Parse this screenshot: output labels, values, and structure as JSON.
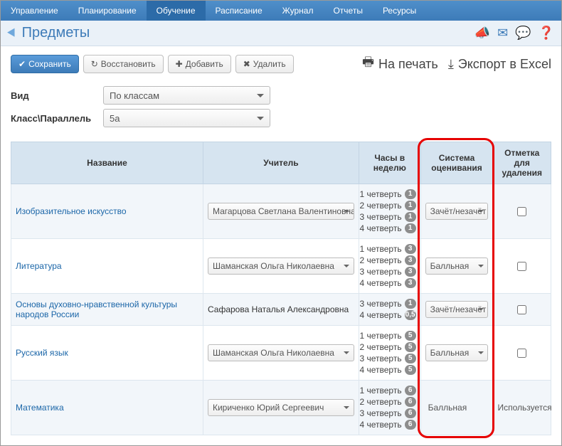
{
  "nav": {
    "items": [
      {
        "label": "Управление"
      },
      {
        "label": "Планирование"
      },
      {
        "label": "Обучение",
        "active": true
      },
      {
        "label": "Расписание"
      },
      {
        "label": "Журнал"
      },
      {
        "label": "Отчеты"
      },
      {
        "label": "Ресурсы"
      }
    ]
  },
  "page_title": "Предметы",
  "toolbar": {
    "save_label": "Сохранить",
    "restore_label": "Восстановить",
    "add_label": "Добавить",
    "delete_label": "Удалить",
    "print_label": "На печать",
    "export_label": "Экспорт в Excel"
  },
  "filters": {
    "view_label": "Вид",
    "view_value": "По классам",
    "class_label": "Класс\\Параллель",
    "class_value": "5а"
  },
  "columns": {
    "name": "Название",
    "teacher": "Учитель",
    "hours": "Часы в неделю",
    "grading": "Система оценивания",
    "delete_mark": "Отметка для удаления"
  },
  "quarter_prefix": "четверть",
  "rows": [
    {
      "subject": "Изобразительное искусство",
      "teacher": "Магарцова Светлана Валентиновна",
      "teacher_has_dropdown": true,
      "hours": [
        {
          "q": "1 четверть",
          "v": "1"
        },
        {
          "q": "2 четверть",
          "v": "1"
        },
        {
          "q": "3 четверть",
          "v": "1"
        },
        {
          "q": "4 четверть",
          "v": "1"
        }
      ],
      "grading": "Зачёт/незачёт",
      "grading_has_dropdown": true,
      "delete_checkbox": true
    },
    {
      "subject": "Литература",
      "teacher": "Шаманская Ольга Николаевна",
      "teacher_has_dropdown": true,
      "hours": [
        {
          "q": "1 четверть",
          "v": "3"
        },
        {
          "q": "2 четверть",
          "v": "3"
        },
        {
          "q": "3 четверть",
          "v": "3"
        },
        {
          "q": "4 четверть",
          "v": "3"
        }
      ],
      "grading": "Балльная",
      "grading_has_dropdown": true,
      "delete_checkbox": true
    },
    {
      "subject": "Основы духовно-нравственной культуры народов России",
      "teacher": "Сафарова Наталья Александровна",
      "teacher_has_dropdown": false,
      "hours": [
        {
          "q": "3 четверть",
          "v": "1"
        },
        {
          "q": "4 четверть",
          "v": "0,5"
        }
      ],
      "grading": "Зачёт/незачёт",
      "grading_has_dropdown": true,
      "delete_checkbox": true
    },
    {
      "subject": "Русский язык",
      "teacher": "Шаманская Ольга Николаевна",
      "teacher_has_dropdown": true,
      "hours": [
        {
          "q": "1 четверть",
          "v": "5"
        },
        {
          "q": "2 четверть",
          "v": "5"
        },
        {
          "q": "3 четверть",
          "v": "5"
        },
        {
          "q": "4 четверть",
          "v": "5"
        }
      ],
      "grading": "Балльная",
      "grading_has_dropdown": true,
      "delete_checkbox": true
    },
    {
      "subject": "Математика",
      "teacher": "Кириченко Юрий Сергеевич",
      "teacher_has_dropdown": true,
      "hours": [
        {
          "q": "1 четверть",
          "v": "6"
        },
        {
          "q": "2 четверть",
          "v": "6"
        },
        {
          "q": "3 четверть",
          "v": "6"
        },
        {
          "q": "4 четверть",
          "v": "6"
        }
      ],
      "grading": "Балльная",
      "grading_has_dropdown": false,
      "delete_checkbox": false,
      "delete_text": "Используется"
    }
  ],
  "highlight_column": "grading",
  "colors": {
    "nav_bg": "#3d7bb8",
    "highlight_border": "#e60000",
    "header_bg": "#d6e4f0",
    "link": "#1b66a8"
  }
}
